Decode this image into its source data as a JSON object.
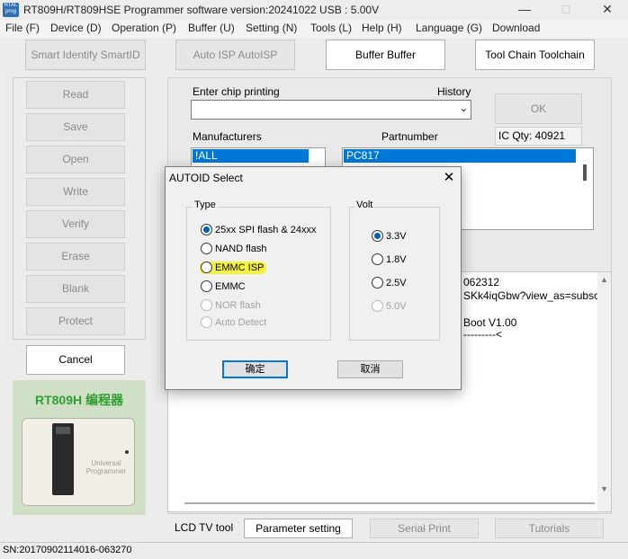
{
  "window": {
    "title": "RT809H/RT809HSE Programmer software version:20241022  USB : 5.00V",
    "logo_text": "RTAL prog"
  },
  "menu": [
    "File (F)",
    "Device (D)",
    "Operation (P)",
    "Buffer (U)",
    "Setting (N)",
    "Tools (L)",
    "Help (H)",
    "Language (G)",
    "Download"
  ],
  "toolbar": {
    "smart_identify": "Smart Identify SmartID",
    "auto_isp": "Auto ISP AutoISP",
    "buffer": "Buffer Buffer",
    "tool_chain": "Tool Chain Toolchain"
  },
  "operations": [
    "Read",
    "Save",
    "Open",
    "Write",
    "Verify",
    "Erase",
    "Blank",
    "Protect"
  ],
  "cancel_label": "Cancel",
  "device_image": {
    "caption": "RT809H 编程器",
    "printed": "Universal Programmer"
  },
  "main": {
    "chip_printing_label": "Enter chip printing",
    "history_label": "History",
    "chip_printing_value": "",
    "ok_label": "OK",
    "manufacturers_label": "Manufacturers",
    "partnumber_label": "Partnumber",
    "ic_qty": "IC Qty: 40921",
    "manufacturer_selected": "!ALL",
    "partnumber_selected": "PC817"
  },
  "log_lines": [
    "062312",
    "SKk4iqGbw?view_as=subsc",
    "",
    "Boot V1.00",
    "---------<"
  ],
  "bottom": {
    "lcd_tv_tool": "LCD TV tool",
    "parameter_setting": "Parameter setting",
    "serial_print": "Serial Print",
    "tutorials": "Tutorials"
  },
  "status": {
    "sn": "SN:20170902114016-063270"
  },
  "dialog": {
    "title": "AUTOID Select",
    "type_label": "Type",
    "volt_label": "Volt",
    "types": [
      {
        "label": "25xx SPI flash & 24xxx",
        "checked": true,
        "disabled": false,
        "highlighted": false
      },
      {
        "label": "NAND flash",
        "checked": false,
        "disabled": false,
        "highlighted": false
      },
      {
        "label": "EMMC ISP",
        "checked": false,
        "disabled": false,
        "highlighted": true
      },
      {
        "label": "EMMC",
        "checked": false,
        "disabled": false,
        "highlighted": false
      },
      {
        "label": "NOR flash",
        "checked": false,
        "disabled": true,
        "highlighted": false
      },
      {
        "label": "Auto Detect",
        "checked": false,
        "disabled": true,
        "highlighted": false
      }
    ],
    "volts": [
      {
        "label": "3.3V",
        "checked": true,
        "disabled": false
      },
      {
        "label": "1.8V",
        "checked": false,
        "disabled": false
      },
      {
        "label": "2.5V",
        "checked": false,
        "disabled": false
      },
      {
        "label": "5.0V",
        "checked": false,
        "disabled": true
      }
    ],
    "confirm_label": "确定",
    "cancel_label": "取消"
  },
  "colors": {
    "selection": "#0078d7",
    "highlight": "#f5f23a",
    "green_caption": "#2e9e2e"
  }
}
